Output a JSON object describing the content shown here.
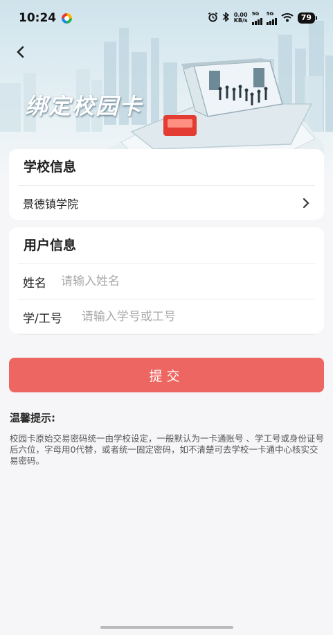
{
  "status_bar": {
    "time": "10:24",
    "net_speed_value": "0.00",
    "net_speed_unit": "KB/s",
    "sim1_label": "5G",
    "sim2_label": "5G",
    "battery": "79"
  },
  "header": {
    "title": "绑定校园卡",
    "back_icon": "chevron-left-icon"
  },
  "school_card": {
    "title": "学校信息",
    "school_name": "景德镇学院",
    "chevron_icon": "chevron-right-icon"
  },
  "user_card": {
    "title": "用户信息",
    "name_label": "姓名",
    "name_placeholder": "请输入姓名",
    "name_value": "",
    "id_label": "学/工号",
    "id_placeholder": "请输入学号或工号",
    "id_value": ""
  },
  "submit_label": "提交",
  "tips": {
    "title": "温馨提示:",
    "text": "校园卡原始交易密码统一由学校设定，一般默认为一卡通账号 、学工号或身份证号后六位，字母用0代替，或者统一固定密码，如不清楚可去学校一卡通中心核实交易密码。"
  },
  "colors": {
    "accent": "#ee6661",
    "background": "#f6f6f8",
    "placeholder": "#a8a8a8"
  }
}
